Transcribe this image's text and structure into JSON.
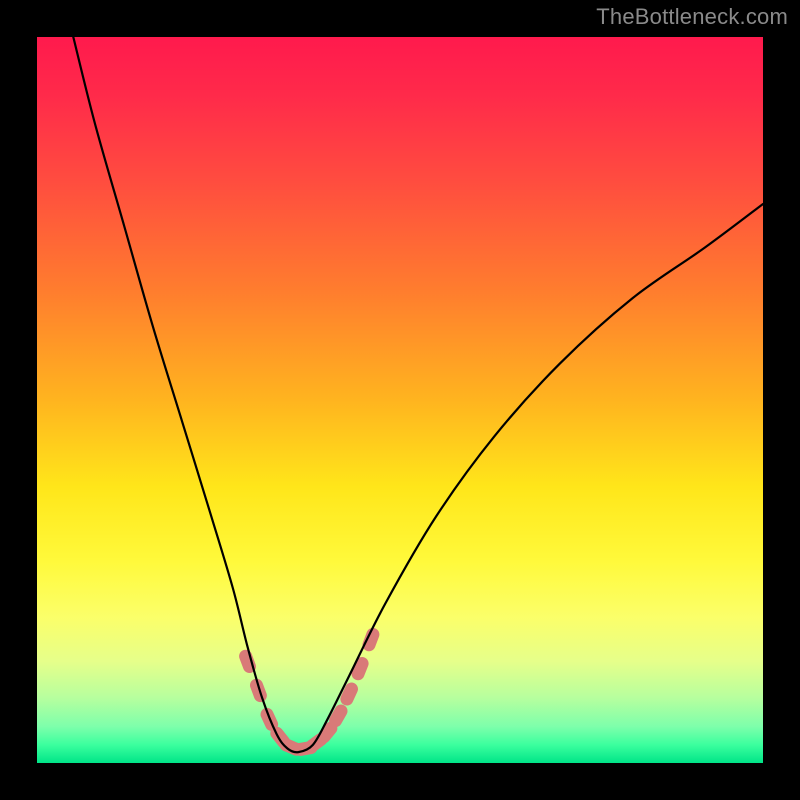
{
  "watermark": "TheBottleneck.com",
  "colors": {
    "background_black": "#000000",
    "gradient_stops": [
      {
        "offset": 0.0,
        "color": "#ff1a4d"
      },
      {
        "offset": 0.08,
        "color": "#ff2a4a"
      },
      {
        "offset": 0.2,
        "color": "#ff4d3f"
      },
      {
        "offset": 0.35,
        "color": "#ff7d2e"
      },
      {
        "offset": 0.5,
        "color": "#ffb41f"
      },
      {
        "offset": 0.62,
        "color": "#ffe61a"
      },
      {
        "offset": 0.72,
        "color": "#fff93a"
      },
      {
        "offset": 0.8,
        "color": "#fbff6a"
      },
      {
        "offset": 0.86,
        "color": "#e6ff8a"
      },
      {
        "offset": 0.91,
        "color": "#b7ff9e"
      },
      {
        "offset": 0.95,
        "color": "#7dffab"
      },
      {
        "offset": 0.975,
        "color": "#3bff9e"
      },
      {
        "offset": 1.0,
        "color": "#00e588"
      }
    ],
    "curve_color": "#000000",
    "marker_color": "#d97a78"
  },
  "chart_data": {
    "type": "line",
    "title": "",
    "xlabel": "",
    "ylabel": "",
    "xlim": [
      0,
      100
    ],
    "ylim": [
      0,
      100
    ],
    "series": [
      {
        "name": "bottleneck-curve",
        "x": [
          5,
          8,
          12,
          16,
          20,
          24,
          27,
          29,
          31,
          33,
          34.5,
          36,
          38,
          40,
          43,
          48,
          55,
          63,
          72,
          82,
          92,
          100
        ],
        "y": [
          100,
          88,
          74,
          60,
          47,
          34,
          24,
          16,
          9,
          4,
          2,
          1.5,
          2.5,
          6,
          12,
          22,
          34,
          45,
          55,
          64,
          71,
          77
        ]
      }
    ],
    "markers": {
      "name": "highlight-markers",
      "x": [
        29,
        30.5,
        32,
        33.5,
        35,
        37,
        38.5,
        40,
        41.5,
        43,
        44.5,
        46
      ],
      "y": [
        14,
        10,
        6,
        3.5,
        2.2,
        2.0,
        2.8,
        4.2,
        6.5,
        9.5,
        13,
        17
      ]
    }
  }
}
